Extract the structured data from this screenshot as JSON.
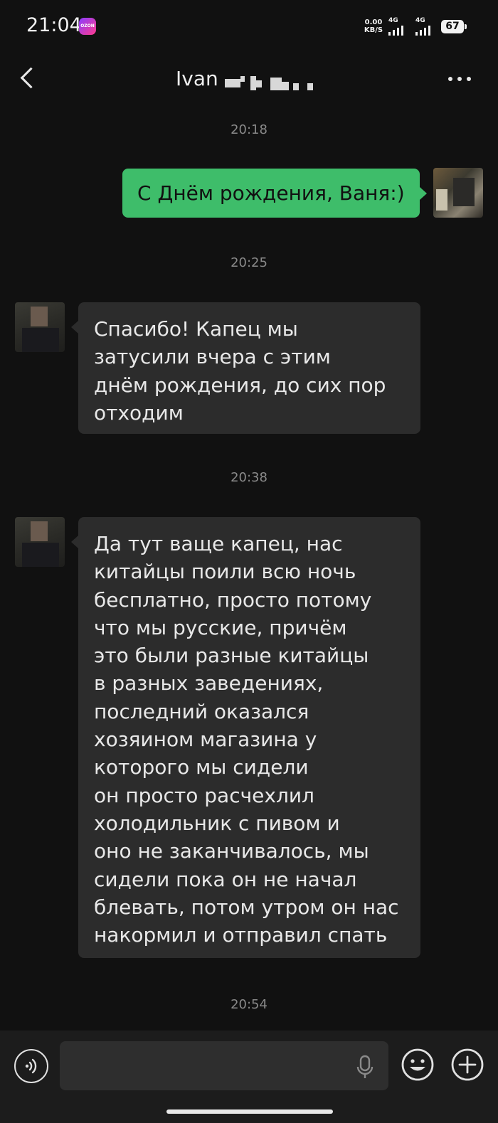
{
  "status_bar": {
    "time": "21:04",
    "app_badge": "OZON",
    "net_speed_value": "0.00",
    "net_speed_unit": "KB/S",
    "signal_1_label": "4G",
    "signal_2_label": "4G",
    "battery": "67"
  },
  "header": {
    "contact_name": "Ivan"
  },
  "messages": [
    {
      "timestamp": "20:18"
    },
    {
      "sender": "self",
      "text": "С Днём рождения, Ваня:)"
    },
    {
      "timestamp": "20:25"
    },
    {
      "sender": "contact",
      "lines": [
        "Спасибо! Капец мы",
        "затусили вчера с этим",
        "днём рождения, до сих пор",
        "отходим"
      ]
    },
    {
      "timestamp": "20:38"
    },
    {
      "sender": "contact",
      "lines": [
        "Да тут ваще капец, нас",
        "китайцы поили всю ночь",
        "бесплатно, просто потому",
        "что мы русские, причём",
        "это были разные китайцы",
        "в разных заведениях,",
        "последний оказался",
        "хозяином магазина у",
        "которого мы сидели",
        "он просто расчехлил",
        "холодильник с пивом и",
        "оно не заканчивалось, мы",
        "сидели пока он не начал",
        "блевать, потом утром он нас",
        "накормил и отправил спать"
      ]
    },
    {
      "timestamp": "20:54"
    }
  ],
  "input_bar": {
    "message_value": ""
  }
}
